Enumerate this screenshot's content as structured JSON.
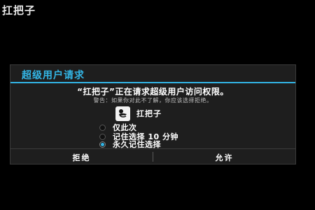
{
  "app": {
    "title": "扛把子"
  },
  "dialog": {
    "title": "超级用户请求",
    "message": "“扛把子”正在请求超级用户访问权限。",
    "warning": "警告：如果你对此不了解，你应该选择拒绝。",
    "requesting_app": {
      "name": "扛把子",
      "icon": "app-icon"
    },
    "options": [
      {
        "label": "仅此次",
        "selected": false
      },
      {
        "label": "记住选择 10 分钟",
        "selected": false
      },
      {
        "label": "永久记住选择",
        "selected": true
      }
    ],
    "buttons": {
      "deny": "拒绝",
      "allow": "允许"
    }
  },
  "colors": {
    "accent": "#33b5e5",
    "dialog_background": "#1e1e1e",
    "screen_background": "#000000"
  }
}
